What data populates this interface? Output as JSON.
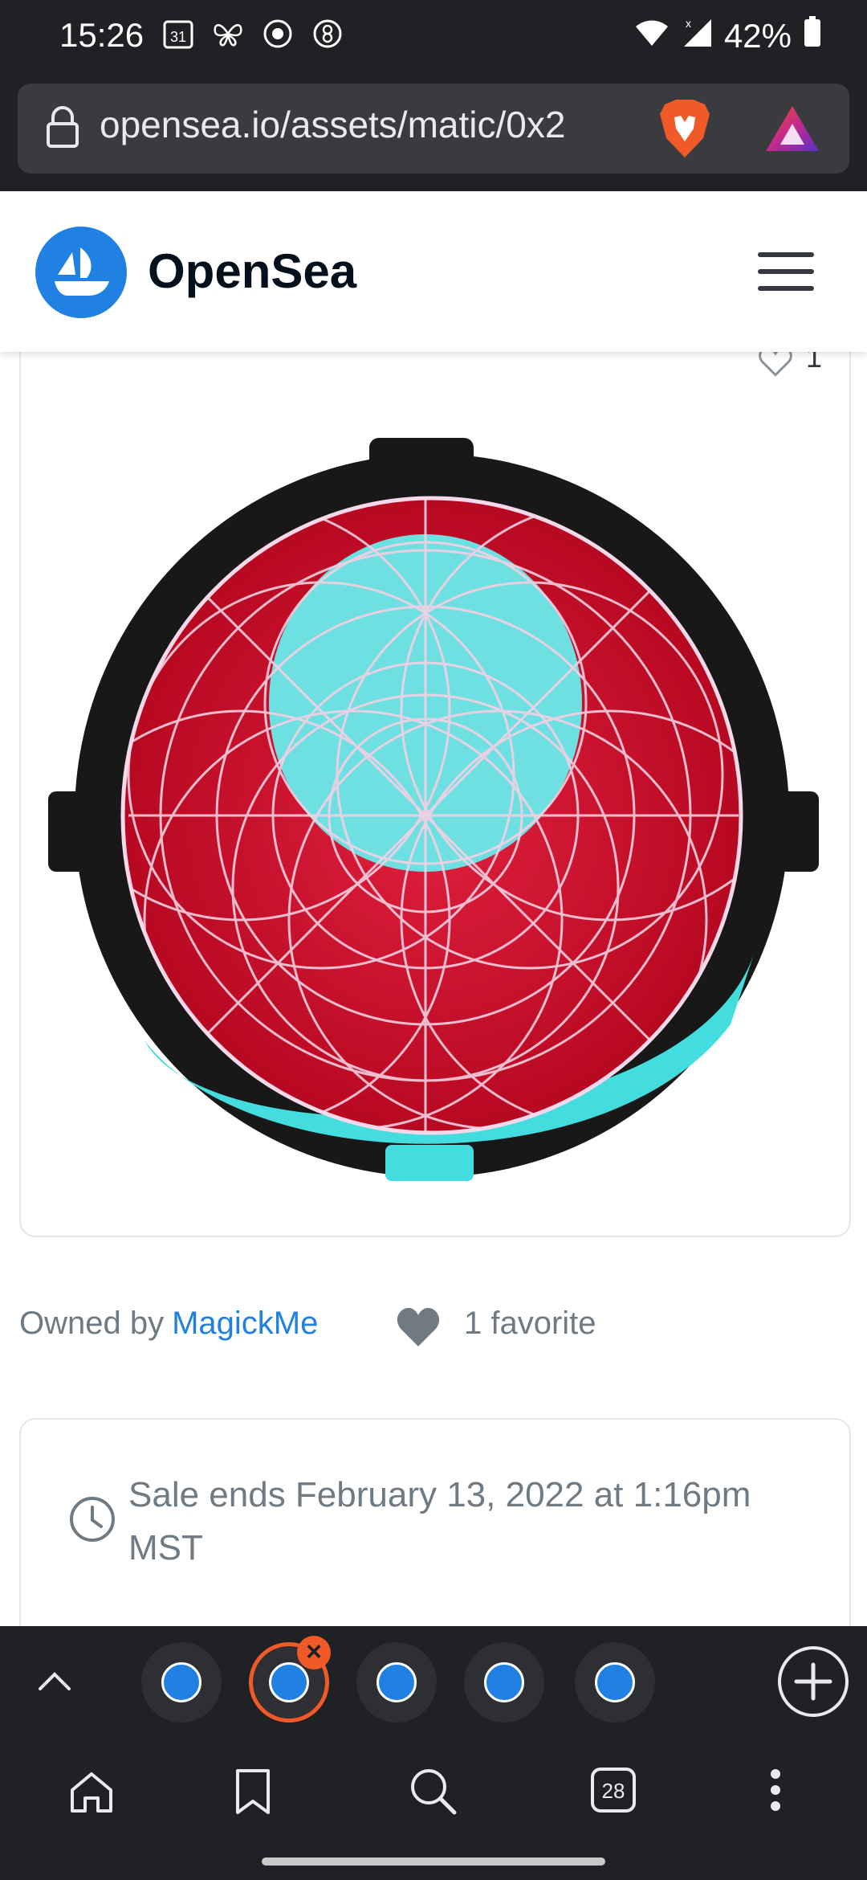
{
  "status_bar": {
    "time": "15:26",
    "calendar_day": "31",
    "battery": "42%",
    "icons": [
      "calendar-icon",
      "butterfly-icon",
      "record-icon",
      "vpn-icon",
      "wifi-icon",
      "signal-icon",
      "battery-icon"
    ]
  },
  "browser": {
    "url": "opensea.io/assets/matic/0x2",
    "lock_icon": "lock-icon",
    "brave_icon": "brave-lion-icon",
    "rewards_icon": "brave-rewards-icon"
  },
  "header": {
    "brand": "OpenSea",
    "logo_icon": "opensea-logo-icon",
    "menu_icon": "hamburger-menu-icon"
  },
  "artwork": {
    "like_count": "1",
    "heart_icon": "heart-outline-icon"
  },
  "owner": {
    "label": "Owned by",
    "name": "MagickMe",
    "favorites": "1 favorite",
    "fav_icon": "heart-filled-icon"
  },
  "sale": {
    "text": "Sale ends February 13, 2022 at 1:16pm MST",
    "clock_icon": "clock-icon"
  },
  "tab_strip": {
    "collapse_icon": "chevron-up-icon",
    "add_icon": "add-tab-icon",
    "tab_count": 5,
    "active_tab": 2
  },
  "bottom_nav": {
    "tabs_count": "28",
    "icons": [
      "home-icon",
      "bookmark-icon",
      "search-icon",
      "tabs-icon",
      "more-icon"
    ]
  },
  "colors": {
    "accent": "#2081e2",
    "active_tab_ring": "#f05a28",
    "chrome_bg": "#202124"
  }
}
